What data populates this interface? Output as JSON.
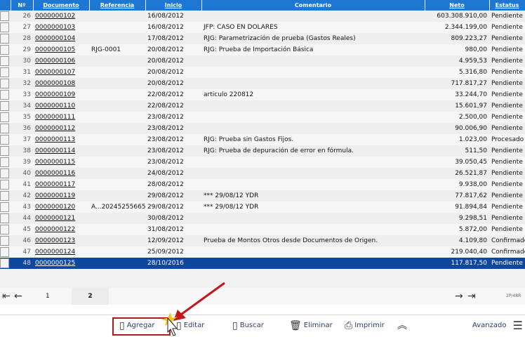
{
  "columns": {
    "num": "Nº",
    "documento": "Documento",
    "referencia": "Referencia",
    "inicio": "Inicio",
    "comentario": "Comentario",
    "neto": "Neto",
    "estatus": "Estatus"
  },
  "rows": [
    {
      "n": "26",
      "doc": "0000000102",
      "ref": "",
      "inicio": "16/08/2012",
      "com": "",
      "neto": "603.308.910,00",
      "est": "Pendiente"
    },
    {
      "n": "27",
      "doc": "0000000103",
      "ref": "",
      "inicio": "16/08/2012",
      "com": "JFP: CASO EN DOLARES",
      "neto": "2.344.199,00",
      "est": "Pendiente"
    },
    {
      "n": "28",
      "doc": "0000000104",
      "ref": "",
      "inicio": "17/08/2012",
      "com": "RJG: Parametrización de prueba (Gastos Reales)",
      "neto": "809.223,27",
      "est": "Pendiente"
    },
    {
      "n": "29",
      "doc": "0000000105",
      "ref": "RJG-0001",
      "inicio": "20/08/2012",
      "com": "RJG: Prueba de Importación Básica",
      "neto": "980,00",
      "est": "Pendiente"
    },
    {
      "n": "30",
      "doc": "0000000106",
      "ref": "",
      "inicio": "20/08/2012",
      "com": "",
      "neto": "4.959,53",
      "est": "Pendiente"
    },
    {
      "n": "31",
      "doc": "0000000107",
      "ref": "",
      "inicio": "20/08/2012",
      "com": "",
      "neto": "5.316,80",
      "est": "Pendiente"
    },
    {
      "n": "32",
      "doc": "0000000108",
      "ref": "",
      "inicio": "20/08/2012",
      "com": "",
      "neto": "717.817,27",
      "est": "Pendiente"
    },
    {
      "n": "33",
      "doc": "0000000109",
      "ref": "",
      "inicio": "22/08/2012",
      "com": "articulo 220812",
      "neto": "33.244,70",
      "est": "Pendiente"
    },
    {
      "n": "34",
      "doc": "0000000110",
      "ref": "",
      "inicio": "22/08/2012",
      "com": "",
      "neto": "15.601,97",
      "est": "Pendiente"
    },
    {
      "n": "35",
      "doc": "0000000111",
      "ref": "",
      "inicio": "23/08/2012",
      "com": "",
      "neto": "2.500,00",
      "est": "Pendiente"
    },
    {
      "n": "36",
      "doc": "0000000112",
      "ref": "",
      "inicio": "23/08/2012",
      "com": "",
      "neto": "90.006,90",
      "est": "Pendiente"
    },
    {
      "n": "37",
      "doc": "0000000113",
      "ref": "",
      "inicio": "23/08/2012",
      "com": "RJG: Prueba sin Gastos Fijos.",
      "neto": "1.023,00",
      "est": "Procesado"
    },
    {
      "n": "38",
      "doc": "0000000114",
      "ref": "",
      "inicio": "23/08/2012",
      "com": "RJG: Prueba de depuración de error en fórmula.",
      "neto": "511,50",
      "est": "Pendiente"
    },
    {
      "n": "39",
      "doc": "0000000115",
      "ref": "",
      "inicio": "23/08/2012",
      "com": "",
      "neto": "39.050,45",
      "est": "Pendiente"
    },
    {
      "n": "40",
      "doc": "0000000116",
      "ref": "",
      "inicio": "24/08/2012",
      "com": "",
      "neto": "26.521,87",
      "est": "Pendiente"
    },
    {
      "n": "41",
      "doc": "0000000117",
      "ref": "",
      "inicio": "28/08/2012",
      "com": "",
      "neto": "9.938,00",
      "est": "Pendiente"
    },
    {
      "n": "42",
      "doc": "0000000119",
      "ref": "",
      "inicio": "29/08/2012",
      "com": "*** 29/08/12 YDR",
      "neto": "77.817,62",
      "est": "Pendiente"
    },
    {
      "n": "43",
      "doc": "0000000120",
      "ref": "A...202452556655",
      "inicio": "29/08/2012",
      "com": "*** 29/08/12 YDR",
      "neto": "91.894,84",
      "est": "Pendiente"
    },
    {
      "n": "44",
      "doc": "0000000121",
      "ref": "",
      "inicio": "30/08/2012",
      "com": "",
      "neto": "9.298,51",
      "est": "Pendiente"
    },
    {
      "n": "45",
      "doc": "0000000122",
      "ref": "",
      "inicio": "31/08/2012",
      "com": "",
      "neto": "5.872,00",
      "est": "Pendiente"
    },
    {
      "n": "46",
      "doc": "0000000123",
      "ref": "",
      "inicio": "12/09/2012",
      "com": "Prueba de Montos Otros desde Documentos de Origen.",
      "neto": "4.109,80",
      "est": "Confirmado"
    },
    {
      "n": "47",
      "doc": "0000000124",
      "ref": "",
      "inicio": "25/09/2012",
      "com": "",
      "neto": "219.040,40",
      "est": "Confirmado"
    },
    {
      "n": "48",
      "doc": "0000000125",
      "ref": "",
      "inicio": "28/10/2016",
      "com": "",
      "neto": "117.817,50",
      "est": "Pendiente",
      "selected": true
    }
  ],
  "pager": {
    "first": "⇤",
    "prev": "←",
    "page1": "1",
    "page2": "2",
    "next": "→",
    "last": "⇥",
    "info": "2P/48R"
  },
  "toolbar": {
    "agregar": "Agregar",
    "editar": "Editar",
    "buscar": "Buscar",
    "eliminar": "Eliminar",
    "imprimir": "Imprimir",
    "avanzado": "Avanzado"
  },
  "colors": {
    "header": "#1e77d2",
    "selected": "#0e47a1",
    "highlight": "#b01a1a"
  }
}
